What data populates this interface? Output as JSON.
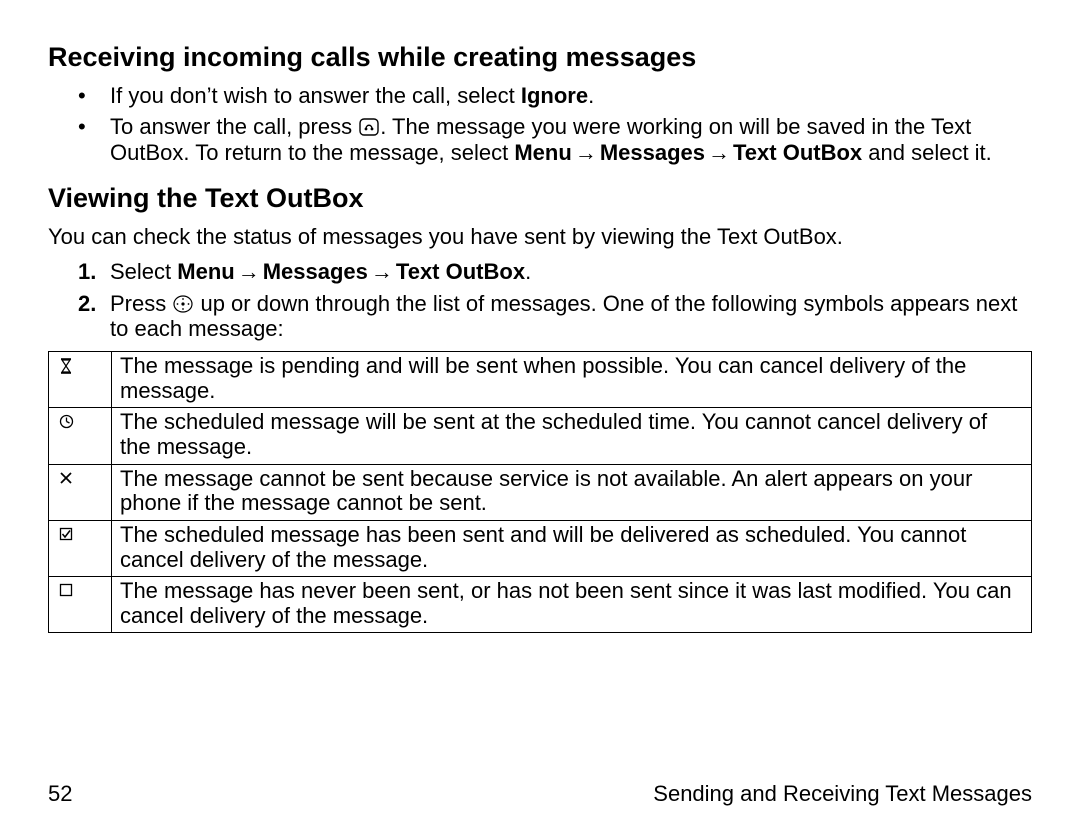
{
  "section1": {
    "heading": "Receiving incoming calls while creating messages",
    "bullets": [
      {
        "pre": "If you don’t wish to answer the call, select ",
        "bold": "Ignore",
        "post": "."
      },
      {
        "pre": "To answer the call, press ",
        "icon": "send-key-icon",
        "mid": ". The message you were working on will be saved in the Text OutBox. To return to the message, select ",
        "navA": "Menu",
        "navB": "Messages",
        "navC": "Text OutBox",
        "post": " and select it."
      }
    ]
  },
  "section2": {
    "heading": "Viewing the Text OutBox",
    "para": "You can check the status of messages you have sent by viewing the Text OutBox.",
    "step1": {
      "pre": "Select ",
      "navA": "Menu",
      "navB": "Messages",
      "navC": "Text OutBox",
      "post": "."
    },
    "step2": {
      "pre": "Press ",
      "icon": "nav-key-icon",
      "post": " up or down through the list of messages. One of the following symbols appears next to each message:"
    },
    "rows": [
      {
        "sym": "hourglass-icon",
        "text": "The message is pending and will be sent when possible. You can cancel delivery of the message."
      },
      {
        "sym": "clock-icon",
        "text": "The scheduled message will be sent at the scheduled time. You cannot cancel delivery of the message."
      },
      {
        "sym": "x-icon",
        "text": "The message cannot be sent because service is not available. An alert appears on your phone if the message cannot be sent."
      },
      {
        "sym": "checked-box-icon",
        "text": "The scheduled message has been sent and will be delivered as scheduled. You cannot cancel delivery of the message."
      },
      {
        "sym": "empty-box-icon",
        "text": "The message has never been sent, or has not been sent since it was last modified. You can cancel delivery of the message."
      }
    ]
  },
  "footer": {
    "page": "52",
    "title": "Sending and Receiving Text Messages"
  },
  "arrow": "→"
}
